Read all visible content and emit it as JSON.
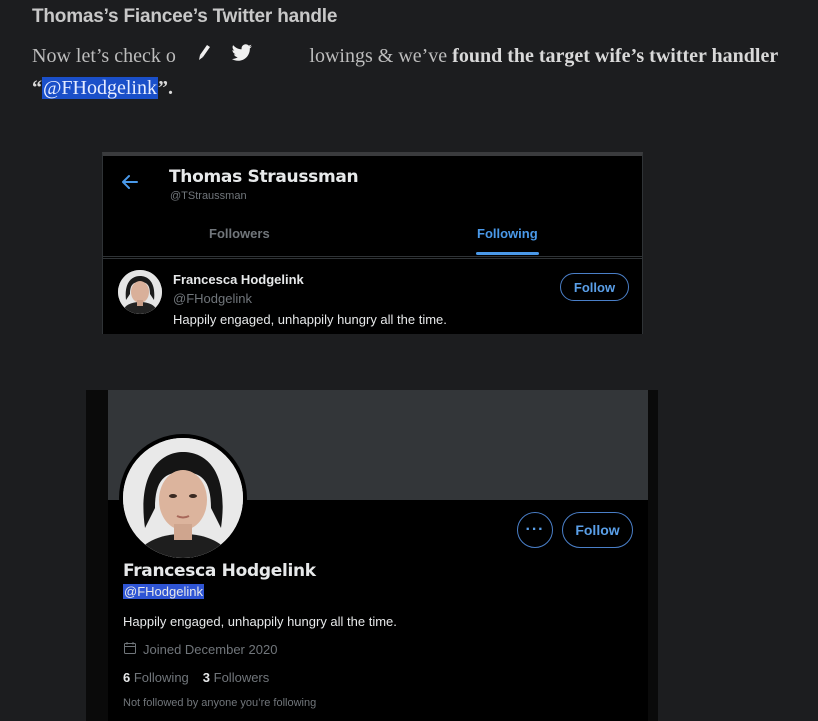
{
  "article": {
    "heading": "Thomas’s Fiancee’s Twitter handle",
    "para_part1": "Now let’s check o",
    "para_part2": "ollowings & we’ve ",
    "para_bold": "found the target wife’s twitter handler “",
    "para_link": "@FHodgelink",
    "para_end": "”."
  },
  "share_toolbar": {
    "icons": [
      "pen-icon",
      "twitter-bird-icon"
    ]
  },
  "following_card": {
    "profile_name": "Thomas Straussman",
    "profile_handle": "@TStraussman",
    "tabs": [
      {
        "label": "Followers"
      },
      {
        "label": "Following"
      }
    ],
    "active_tab": "Following",
    "user": {
      "name": "Francesca Hodgelink",
      "handle": "@FHodgelink",
      "bio": "Happily engaged, unhappily hungry all the time.",
      "follow_label": "Follow"
    }
  },
  "profile_card": {
    "name": "Francesca Hodgelink",
    "handle": "@FHodgelink",
    "bio": "Happily engaged, unhappily hungry all the time.",
    "joined": "Joined December 2020",
    "following_count": "6",
    "following_label": "Following",
    "followers_count": "3",
    "followers_label": "Followers",
    "not_followed": "Not followed by anyone you’re following",
    "more_label": "···",
    "follow_label": "Follow"
  },
  "colors": {
    "accent": "#4a99e9",
    "background": "#1c1d1f",
    "highlight": "#1a4fc9"
  }
}
